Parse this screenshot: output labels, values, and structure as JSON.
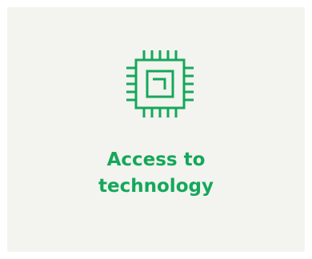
{
  "card": {
    "icon": "cpu-chip-icon",
    "title_line1": "Access to",
    "title_line2": "technology",
    "accent_color": "#14a85a",
    "background_color": "#f3f3ef"
  }
}
